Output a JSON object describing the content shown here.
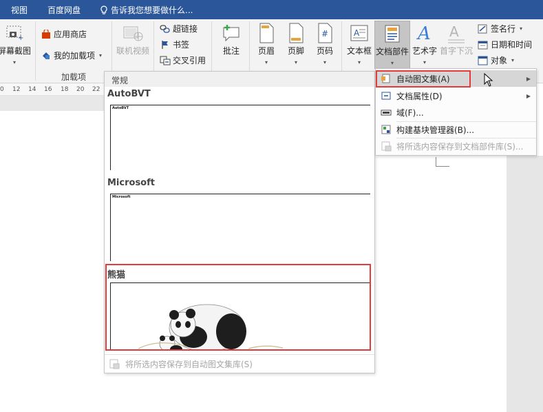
{
  "tabs": [
    {
      "label": "视图"
    },
    {
      "label": "百度网盘"
    }
  ],
  "tellme": {
    "placeholder": "告诉我您想要做什么..."
  },
  "ribbon": {
    "screenshot": {
      "label": "屏幕截图"
    },
    "appstore": {
      "label": "应用商店"
    },
    "myaddins": {
      "label": "我的加载项"
    },
    "addins_group": "加载项",
    "onlinevideo": {
      "label": "联机视频"
    },
    "hyperlink": {
      "label": "超链接"
    },
    "bookmark": {
      "label": "书签"
    },
    "crossref": {
      "label": "交叉引用"
    },
    "comment": {
      "label": "批注"
    },
    "header": {
      "label": "页眉"
    },
    "footer": {
      "label": "页脚"
    },
    "pagenum": {
      "label": "页码"
    },
    "textbox": {
      "label": "文本框"
    },
    "quickparts": {
      "label": "文档部件"
    },
    "wordart": {
      "label": "艺术字"
    },
    "dropcap": {
      "label": "首字下沉"
    },
    "signature": {
      "label": "签名行"
    },
    "datetime": {
      "label": "日期和时间"
    },
    "object": {
      "label": "对象"
    }
  },
  "ruler": {
    "ticks": [
      "0",
      "12",
      "14",
      "16",
      "18",
      "20",
      "22"
    ]
  },
  "gallery": {
    "section": "常规",
    "entries": [
      {
        "title": "AutoBVT",
        "preview_text": "AutoBVT"
      },
      {
        "title": "Microsoft",
        "preview_text": "Microsoft"
      },
      {
        "title": "熊猫"
      }
    ],
    "footer": "将所选内容保存到自动图文集库(S)"
  },
  "submenu": {
    "items": [
      {
        "label": "自动图文集(A)"
      },
      {
        "label": "文档属性(D)"
      },
      {
        "label": "域(F)..."
      },
      {
        "label": "构建基块管理器(B)..."
      },
      {
        "label": "将所选内容保存到文档部件库(S)..."
      }
    ]
  },
  "colors": {
    "tabbar": "#2b579a",
    "highlight_border": "#e23b3b",
    "menu_hover": "#d6d6d6"
  },
  "icons": [
    "lightbulb-icon",
    "camera-icon",
    "store-icon",
    "addins-icon",
    "video-icon",
    "link-icon",
    "bookmark-icon",
    "crossref-icon",
    "comment-icon",
    "header-icon",
    "footer-icon",
    "pagenum-icon",
    "textbox-icon",
    "quickparts-icon",
    "wordart-icon",
    "dropcap-icon",
    "signature-icon",
    "calendar-icon",
    "object-icon",
    "autotext-icon",
    "docprop-icon",
    "field-icon",
    "organizer-icon",
    "save-gallery-icon",
    "panda-illustration",
    "mouse-cursor-icon"
  ]
}
